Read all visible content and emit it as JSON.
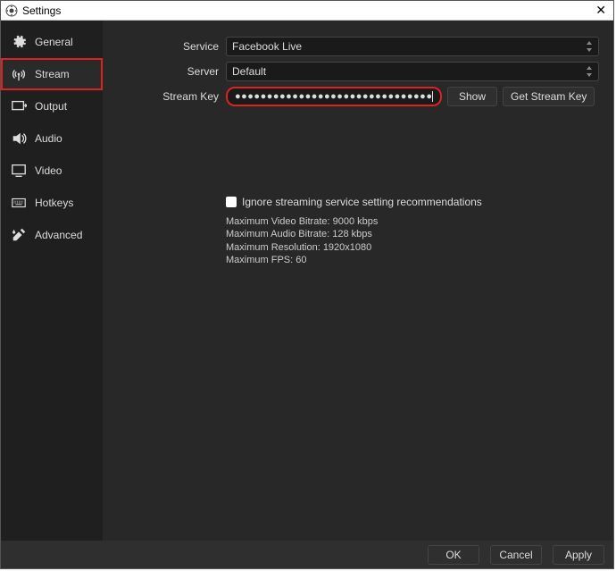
{
  "window": {
    "title": "Settings"
  },
  "sidebar": {
    "items": [
      {
        "label": "General"
      },
      {
        "label": "Stream"
      },
      {
        "label": "Output"
      },
      {
        "label": "Audio"
      },
      {
        "label": "Video"
      },
      {
        "label": "Hotkeys"
      },
      {
        "label": "Advanced"
      }
    ]
  },
  "form": {
    "service_label": "Service",
    "service_value": "Facebook Live",
    "server_label": "Server",
    "server_value": "Default",
    "streamkey_label": "Stream Key",
    "streamkey_mask": "●●●●●●●●●●●●●●●●●●●●●●●●●●●●●●●●●●●●●●●●",
    "show_btn": "Show",
    "getkey_btn": "Get Stream Key"
  },
  "info": {
    "ignore_label": "Ignore streaming service setting recommendations",
    "line1": "Maximum Video Bitrate: 9000 kbps",
    "line2": "Maximum Audio Bitrate: 128 kbps",
    "line3": "Maximum Resolution: 1920x1080",
    "line4": "Maximum FPS: 60"
  },
  "buttons": {
    "ok": "OK",
    "cancel": "Cancel",
    "apply": "Apply"
  }
}
